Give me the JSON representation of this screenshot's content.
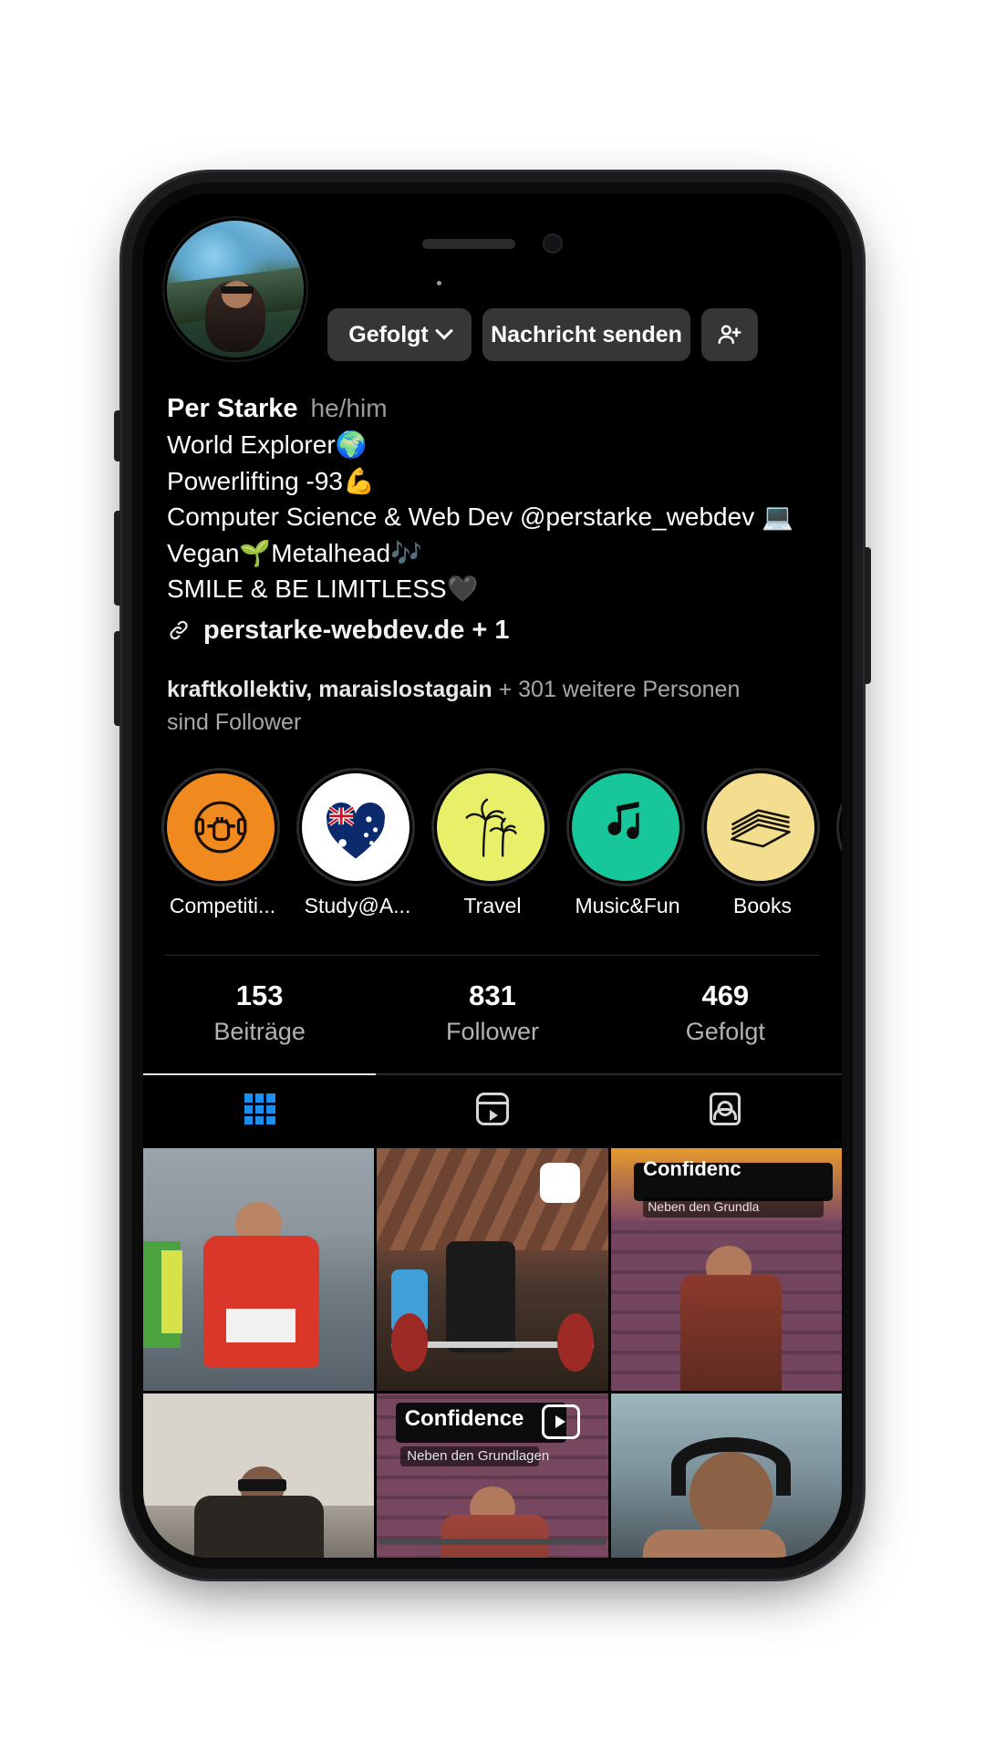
{
  "app": "instagram-profile",
  "profile": {
    "avatar_name": "profile-photo",
    "actions": {
      "followed_label": "Gefolgt",
      "message_label": "Nachricht senden",
      "add_user_label": "+"
    },
    "name": "Per Starke",
    "pronouns": "he/him",
    "bio_lines": [
      "World Explorer🌍",
      "Powerlifting -93💪",
      "Computer Science & Web Dev @perstarke_webdev 💻",
      "Vegan🌱Metalhead🎶",
      "SMILE & BE LIMITLESS🖤"
    ],
    "link_text": "perstarke-webdev.de + 1",
    "mutuals_bold": "kraftkollektiv, maraislostagain",
    "mutuals_rest": " + 301 weitere Personen sind Follower"
  },
  "highlights": [
    {
      "label": "Competiti...",
      "icon": "dumbbell-fist-icon",
      "bg": "#F08A1E"
    },
    {
      "label": "Study@A...",
      "icon": "australia-flag-heart-icon",
      "bg": "#FFFFFF"
    },
    {
      "label": "Travel",
      "icon": "palm-trees-icon",
      "bg": "#E8F06A"
    },
    {
      "label": "Music&Fun",
      "icon": "music-notes-icon",
      "bg": "#17C79A"
    },
    {
      "label": "Books",
      "icon": "open-book-icon",
      "bg": "#F2DE8E"
    },
    {
      "label": "",
      "icon": "partial-highlight-icon",
      "bg": "#EFE96C"
    }
  ],
  "stats": [
    {
      "value": "153",
      "label": "Beiträge"
    },
    {
      "value": "831",
      "label": "Follower"
    },
    {
      "value": "469",
      "label": "Gefolgt"
    }
  ],
  "tabs": [
    {
      "name": "grid",
      "icon": "grid-icon",
      "active": true
    },
    {
      "name": "reels",
      "icon": "reels-icon",
      "active": false
    },
    {
      "name": "tagged",
      "icon": "tagged-icon",
      "active": false
    }
  ],
  "posts": [
    {
      "name": "post-running-race",
      "overlay_title": "",
      "overlay_sub": ""
    },
    {
      "name": "post-powerlifting-gym",
      "overlay_title": "",
      "overlay_sub": ""
    },
    {
      "name": "post-confidence-reel-1",
      "overlay_title": "Confidenc",
      "overlay_sub": "Neben den Grundla"
    },
    {
      "name": "post-home-portrait",
      "overlay_title": "",
      "overlay_sub": ""
    },
    {
      "name": "post-confidence-reel-2",
      "overlay_title": "Confidence",
      "overlay_sub": "Neben den Grundlagen"
    },
    {
      "name": "post-headphones-portrait",
      "overlay_title": "",
      "overlay_sub": ""
    }
  ],
  "colors": {
    "accent_blue": "#1b8ef2",
    "background": "#000000",
    "button_gray": "#363638",
    "muted_text": "#a7a7a7"
  }
}
